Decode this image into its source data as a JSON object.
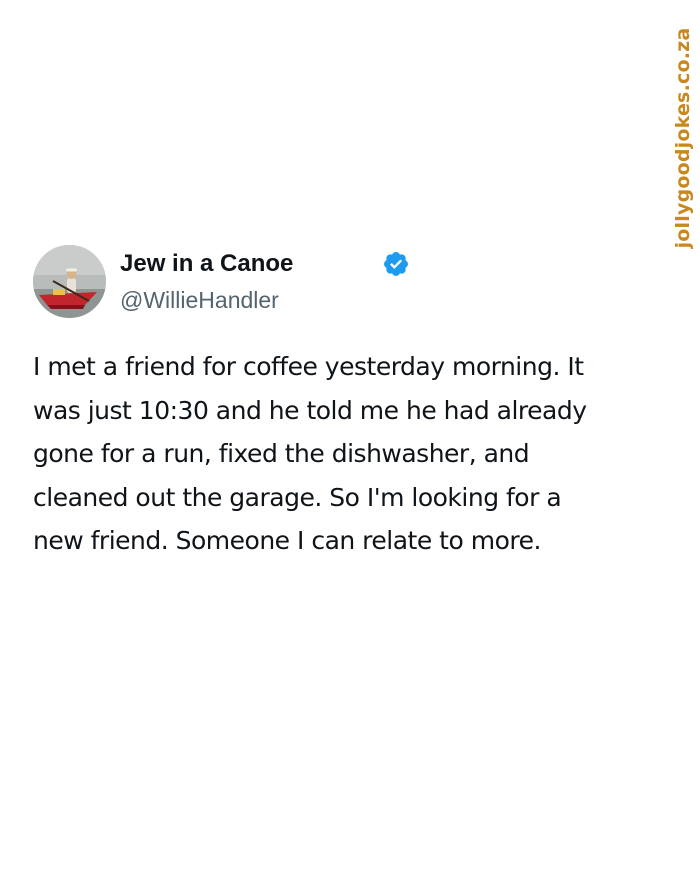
{
  "watermark": "jollygoodjokes.co.za",
  "author": {
    "display_name": "Jew in a Canoe",
    "handle": "@WillieHandler",
    "verified": true,
    "avatar_icon": "profile-photo-man-in-canoe",
    "verified_icon": "verified-badge-icon"
  },
  "tweet": {
    "text": "I met a friend for coffee yesterday morning. It\nwas just 10:30 and he told me he had already\ngone for a run, fixed the dishwasher, and\ncleaned out the garage. So I'm looking for a\nnew friend. Someone I can relate to more."
  },
  "colors": {
    "text": "#0f1419",
    "secondary_text": "#536471",
    "verified_blue": "#1d9bf0",
    "watermark": "#c9881e"
  }
}
